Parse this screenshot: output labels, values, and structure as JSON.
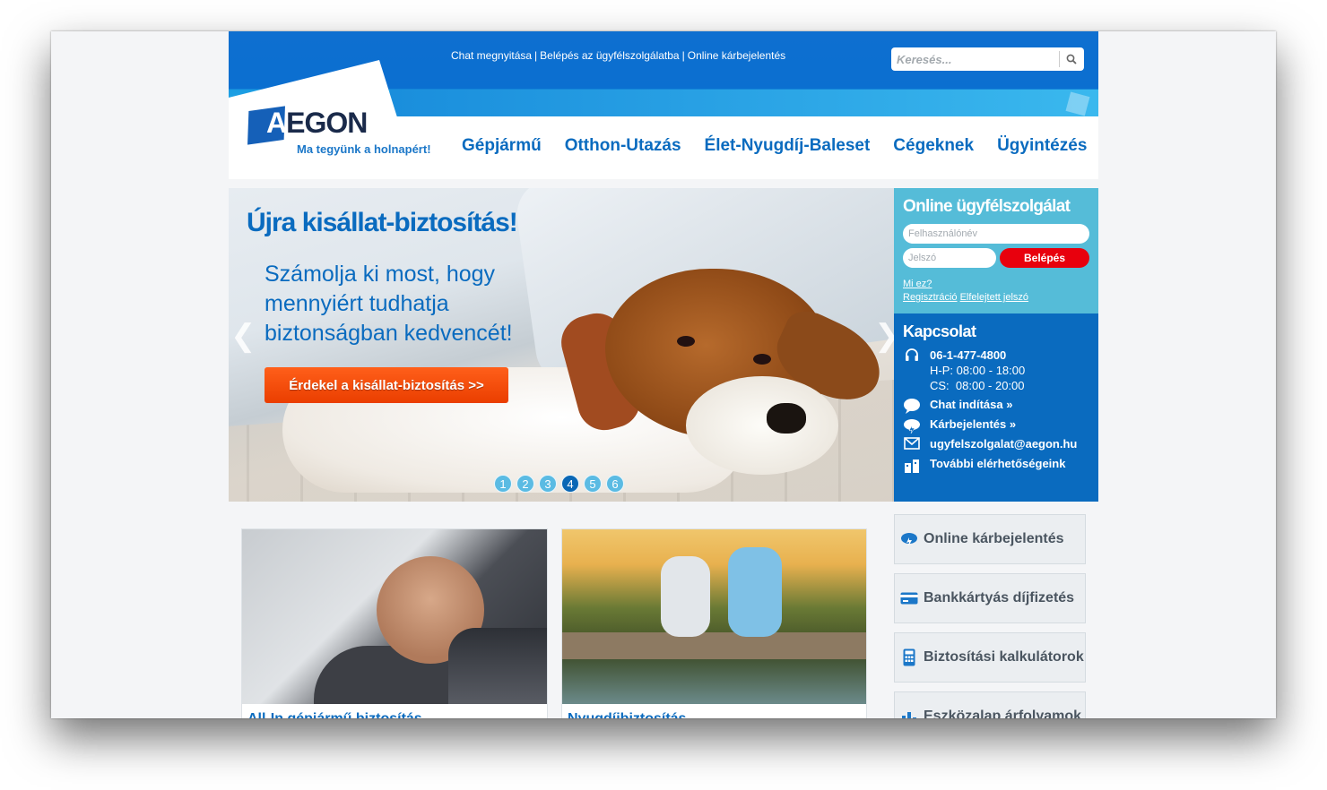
{
  "header": {
    "top_links": [
      "Chat megnyitása",
      "Belépés az ügyfélszolgálatba",
      "Online kárbejelentés"
    ],
    "search_placeholder": "Keresés...",
    "logo_text": "AEGON",
    "slogan": "Ma tegyünk a holnapért!",
    "nav": [
      "Gépjármű",
      "Otthon-Utazás",
      "Élet-Nyugdíj-Baleset",
      "Cégeknek",
      "Ügyintézés"
    ]
  },
  "hero": {
    "title": "Újra kisállat-biztosítás!",
    "text": "Számolja ki most, hogy mennyiért tudhatja biztonságban kedvencét!",
    "cta": "Érdekel a kisállat-biztosítás >>",
    "prev": "❮",
    "next": "❯",
    "slides": [
      "1",
      "2",
      "3",
      "4",
      "5",
      "6"
    ],
    "active_slide": 4
  },
  "login": {
    "title": "Online ügyfélszolgálat",
    "username_placeholder": "Felhasználónév",
    "password_placeholder": "Jelszó",
    "login_button": "Belépés",
    "what_is": "Mi ez?",
    "register": "Regisztráció",
    "forgot": "Elfelejtett jelszó"
  },
  "contact": {
    "title": "Kapcsolat",
    "phone": "06-1-477-4800",
    "hours1": "H-P: 08:00 - 18:00",
    "hours2": "CS:  08:00 - 20:00",
    "chat": "Chat indítása »",
    "claim": "Kárbejelentés »",
    "email": "ugyfelszolgalat@aegon.hu",
    "more": "További elérhetőségeink"
  },
  "cards": [
    {
      "title": "All-In gépjármű biztosítás"
    },
    {
      "title": "Nyugdíjbiztosítás"
    }
  ],
  "side_buttons": [
    {
      "label": "Online kárbejelentés",
      "icon": "cloud-bolt-icon"
    },
    {
      "label": "Bankkártyás díjfizetés",
      "icon": "credit-card-icon"
    },
    {
      "label": "Biztosítási kalkulátorok",
      "icon": "calculator-icon"
    },
    {
      "label": "Eszközalap árfolyamok",
      "icon": "bar-chart-icon"
    }
  ],
  "colors": {
    "brand_blue": "#0a6bbf",
    "light_blue": "#55bcd8",
    "cta_orange": "#ff5f1a",
    "login_red": "#e8000d"
  }
}
